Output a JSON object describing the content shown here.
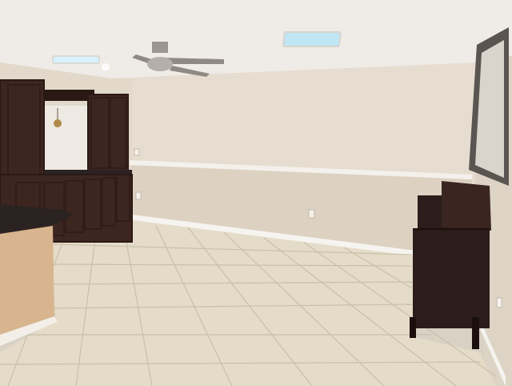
{
  "scene": {
    "description_free": true,
    "colors": {
      "ceiling": "#efebe6",
      "wall_upper": "#e6ddd0",
      "wall_lower": "#ddd2c2",
      "chair_rail": "#f4f1ec",
      "baseboard": "#f6f4f0",
      "floor": "#e4dcc8",
      "grout": "#c9bfa9",
      "cabinet": "#3e2620",
      "cabinet_dark": "#2a1814",
      "counter": "#2b2322",
      "island_body": "#d8b58e",
      "dresser": "#2c1d1a",
      "mirror_frame": "#5a5550",
      "mirror_glass": "#d9d4cc",
      "skylight": "#bfe6f5",
      "fan": "#9c9690"
    }
  }
}
